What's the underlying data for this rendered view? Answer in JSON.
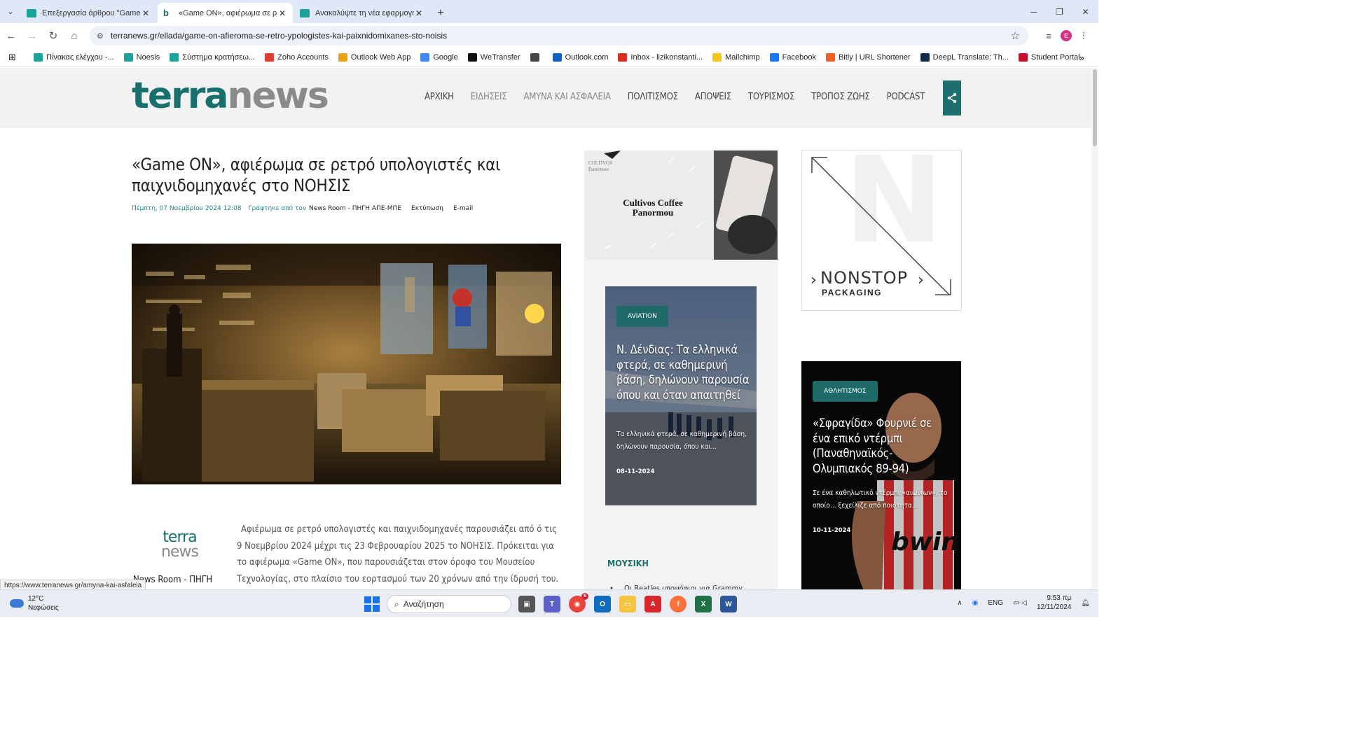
{
  "browser": {
    "tabs": [
      {
        "title": "Επεξεργασία άρθρου \"Game O",
        "active": false
      },
      {
        "title": "«Game ON», αφιέρωμα σε ρετρ",
        "active": true
      },
      {
        "title": "Ανακαλύψτε τη νέα εφαρμογή",
        "active": false
      }
    ],
    "url": "terranews.gr/ellada/game-on-afieroma-se-retro-ypologistes-kai-paixnidomixanes-sto-noisis",
    "profile_initial": "E",
    "bookmarks": [
      {
        "label": "Πίνακας ελέγχου -...",
        "color": "#1aa39a"
      },
      {
        "label": "Noesis",
        "color": "#1aa39a"
      },
      {
        "label": "Σύστημα κρατήσεω...",
        "color": "#1aa39a"
      },
      {
        "label": "Zoho Accounts",
        "color": "#e03c31"
      },
      {
        "label": "Outlook Web App",
        "color": "#e8a317"
      },
      {
        "label": "Google",
        "color": "#4285f4"
      },
      {
        "label": "WeTransfer",
        "color": "#111111"
      },
      {
        "label": "",
        "color": "#444444"
      },
      {
        "label": "Outlook.com",
        "color": "#0a64c8"
      },
      {
        "label": "Inbox - lizikonstanti...",
        "color": "#d93025"
      },
      {
        "label": "Mailchimp",
        "color": "#f5c518"
      },
      {
        "label": "Facebook",
        "color": "#1877f2"
      },
      {
        "label": "Bitly | URL Shortener",
        "color": "#ee6123"
      },
      {
        "label": "DeepL Translate: Th...",
        "color": "#0f2b46"
      },
      {
        "label": "Student Portal",
        "color": "#c8102e"
      }
    ]
  },
  "site": {
    "logo_a": "terra",
    "logo_b": "news",
    "nav": [
      {
        "label": "ΑΡΧΙΚΗ",
        "light": false
      },
      {
        "label": "ΕΙΔΗΣΕΙΣ",
        "light": true
      },
      {
        "label": "ΑΜΥΝΑ ΚΑΙ ΑΣΦΑΛΕΙΑ",
        "light": true
      },
      {
        "label": "ΠΟΛΙΤΙΣΜΟΣ",
        "light": false
      },
      {
        "label": "ΑΠΟΨΕΙΣ",
        "light": false
      },
      {
        "label": "ΤΟΥΡΙΣΜΟΣ",
        "light": false
      },
      {
        "label": "ΤΡΟΠΟΣ ΖΩΗΣ",
        "light": false
      },
      {
        "label": "PODCAST",
        "light": false
      }
    ]
  },
  "article": {
    "title": "«Game ON», αφιέρωμα σε ρετρό υπολογιστές και παιχνιδομηχανές στο ΝΟΗΣΙΣ",
    "date": "Πέμπτη, 07 Νοεμβρίου 2024 12:08",
    "written_by": "Γράφτηκε από τον",
    "author": "News Room - ΠΗΓΗ ΑΠΕ-ΜΠΕ",
    "print": "Εκτύπωση",
    "email": "E-mail",
    "avatar_a": "terra",
    "avatar_b": "news",
    "author_caption": "News Room - ΠΗΓΗ",
    "body": "Αφιέρωμα σε ρετρό υπολογιστές και παιχνιδομηχανές παρουσιάζει από ό τις 9 Νοεμβρίου 2024 μέχρι τις 23 Φεβρουαρίου 2025 το ΝΟΗΣΙΣ. Πρόκειται για το αφιέρωμα «Game ON», που παρουσιάζεται στον όροφο του Μουσείου Τεχνολογίας, στο πλαίσιο του εορτασμού των 20 χρόνων από την ίδρυσή του."
  },
  "ads": {
    "cultivos_small_a": "CULTIVOS",
    "cultivos_small_b": "Panormou",
    "cultivos_line1": "Cultivos Coffee",
    "cultivos_line2": "Panormou",
    "nonstop_main": "NONSTOP",
    "nonstop_sub": "PACKAGING"
  },
  "cards": [
    {
      "badge": "AVIATION",
      "title": "Ν. Δένδιας: Τα ελληνικά φτερά, σε καθημερινή βάση, δηλώνουν παρουσία όπου και όταν απαιτηθεί",
      "excerpt": "Τα ελληνικά φτερά, σε καθημερινή βάση, δηλώνουν παρουσία, όπου και...",
      "date": "08-11-2024"
    },
    {
      "badge": "ΑΘΛΗΤΙΣΜΟΣ",
      "title": "«Σφραγίδα» Φουρνιέ σε ένα επικό ντέρμπι (Παναθηναϊκός-Ολυμπιακός 89-94)",
      "excerpt": "Σε ένα καθηλωτικό ντέρμπι «αιώνιων», το οποίο... ξεχείλιζε από ποιότητα...",
      "date": "10-11-2024",
      "jersey_text": "bwin"
    }
  ],
  "music": {
    "heading": "ΜΟΥΣΙΚΗ",
    "first_item": "Οι Beatles υποψήφιοι για Grammy"
  },
  "status_url": "https://www.terranews.gr/amyna-kai-asfaleia",
  "taskbar": {
    "temp": "12°C",
    "weather": "Νεφώσεις",
    "search_placeholder": "Αναζήτηση",
    "lang": "ENG",
    "time": "9:53 πμ",
    "date": "12/11/2024",
    "chrome_badge": "6"
  }
}
